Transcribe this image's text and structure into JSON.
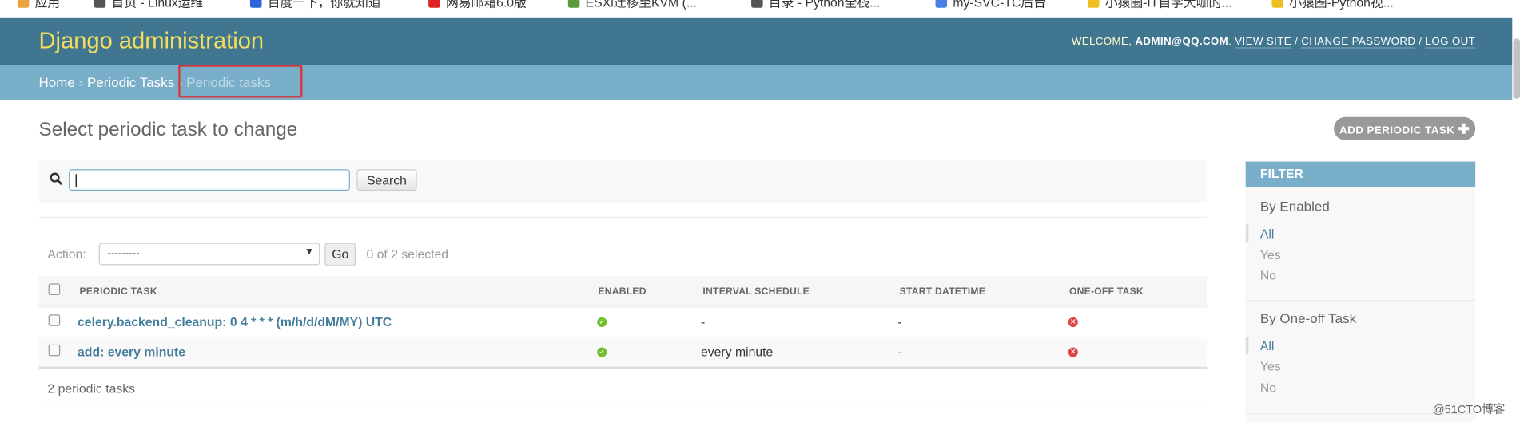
{
  "bookmarks": [
    "应用",
    "首页 - Linux运维",
    "百度一下，你就知道",
    "网易邮箱6.0版",
    "ESXi迁移至KVM (...",
    "目录 - Python全栈...",
    "my-SVC-TC后台",
    "小猿圈-IT自学大咖的...",
    "小猿圈-Python视..."
  ],
  "header": {
    "brand": "Django administration",
    "welcome": "WELCOME,",
    "user": "ADMIN@QQ.COM",
    "view_site": "VIEW SITE",
    "change_password": "CHANGE PASSWORD",
    "log_out": "LOG OUT",
    "sep": "/"
  },
  "breadcrumbs": {
    "home": "Home",
    "app": "Periodic Tasks",
    "current": "Periodic tasks",
    "sep": "›"
  },
  "page": {
    "title": "Select periodic task to change",
    "add_button": "ADD PERIODIC TASK"
  },
  "search": {
    "value": "",
    "button": "Search"
  },
  "actions": {
    "label": "Action:",
    "selected": "---------",
    "go": "Go",
    "count": "0 of 2 selected"
  },
  "table": {
    "headers": [
      "PERIODIC TASK",
      "ENABLED",
      "INTERVAL SCHEDULE",
      "START DATETIME",
      "ONE-OFF TASK"
    ],
    "rows": [
      {
        "name": "celery.backend_cleanup: 0 4 * * * (m/h/d/dM/MY) UTC",
        "enabled": true,
        "interval": "-",
        "start": "-",
        "one_off": false
      },
      {
        "name": "add: every minute",
        "enabled": true,
        "interval": "every minute",
        "start": "-",
        "one_off": false
      }
    ]
  },
  "paginator": "2 periodic tasks",
  "filter": {
    "title": "FILTER",
    "groups": [
      {
        "title": "By Enabled",
        "items": [
          "All",
          "Yes",
          "No"
        ],
        "selected": "All"
      },
      {
        "title": "By One-off Task",
        "items": [
          "All",
          "Yes",
          "No"
        ],
        "selected": "All"
      }
    ]
  },
  "watermark": "@51CTO博客",
  "colors": {
    "header": "#417690",
    "breadcrumbs": "#79aec8",
    "brand": "#f5dd5d",
    "link": "#447e9b",
    "highlight": "#d9363e"
  }
}
